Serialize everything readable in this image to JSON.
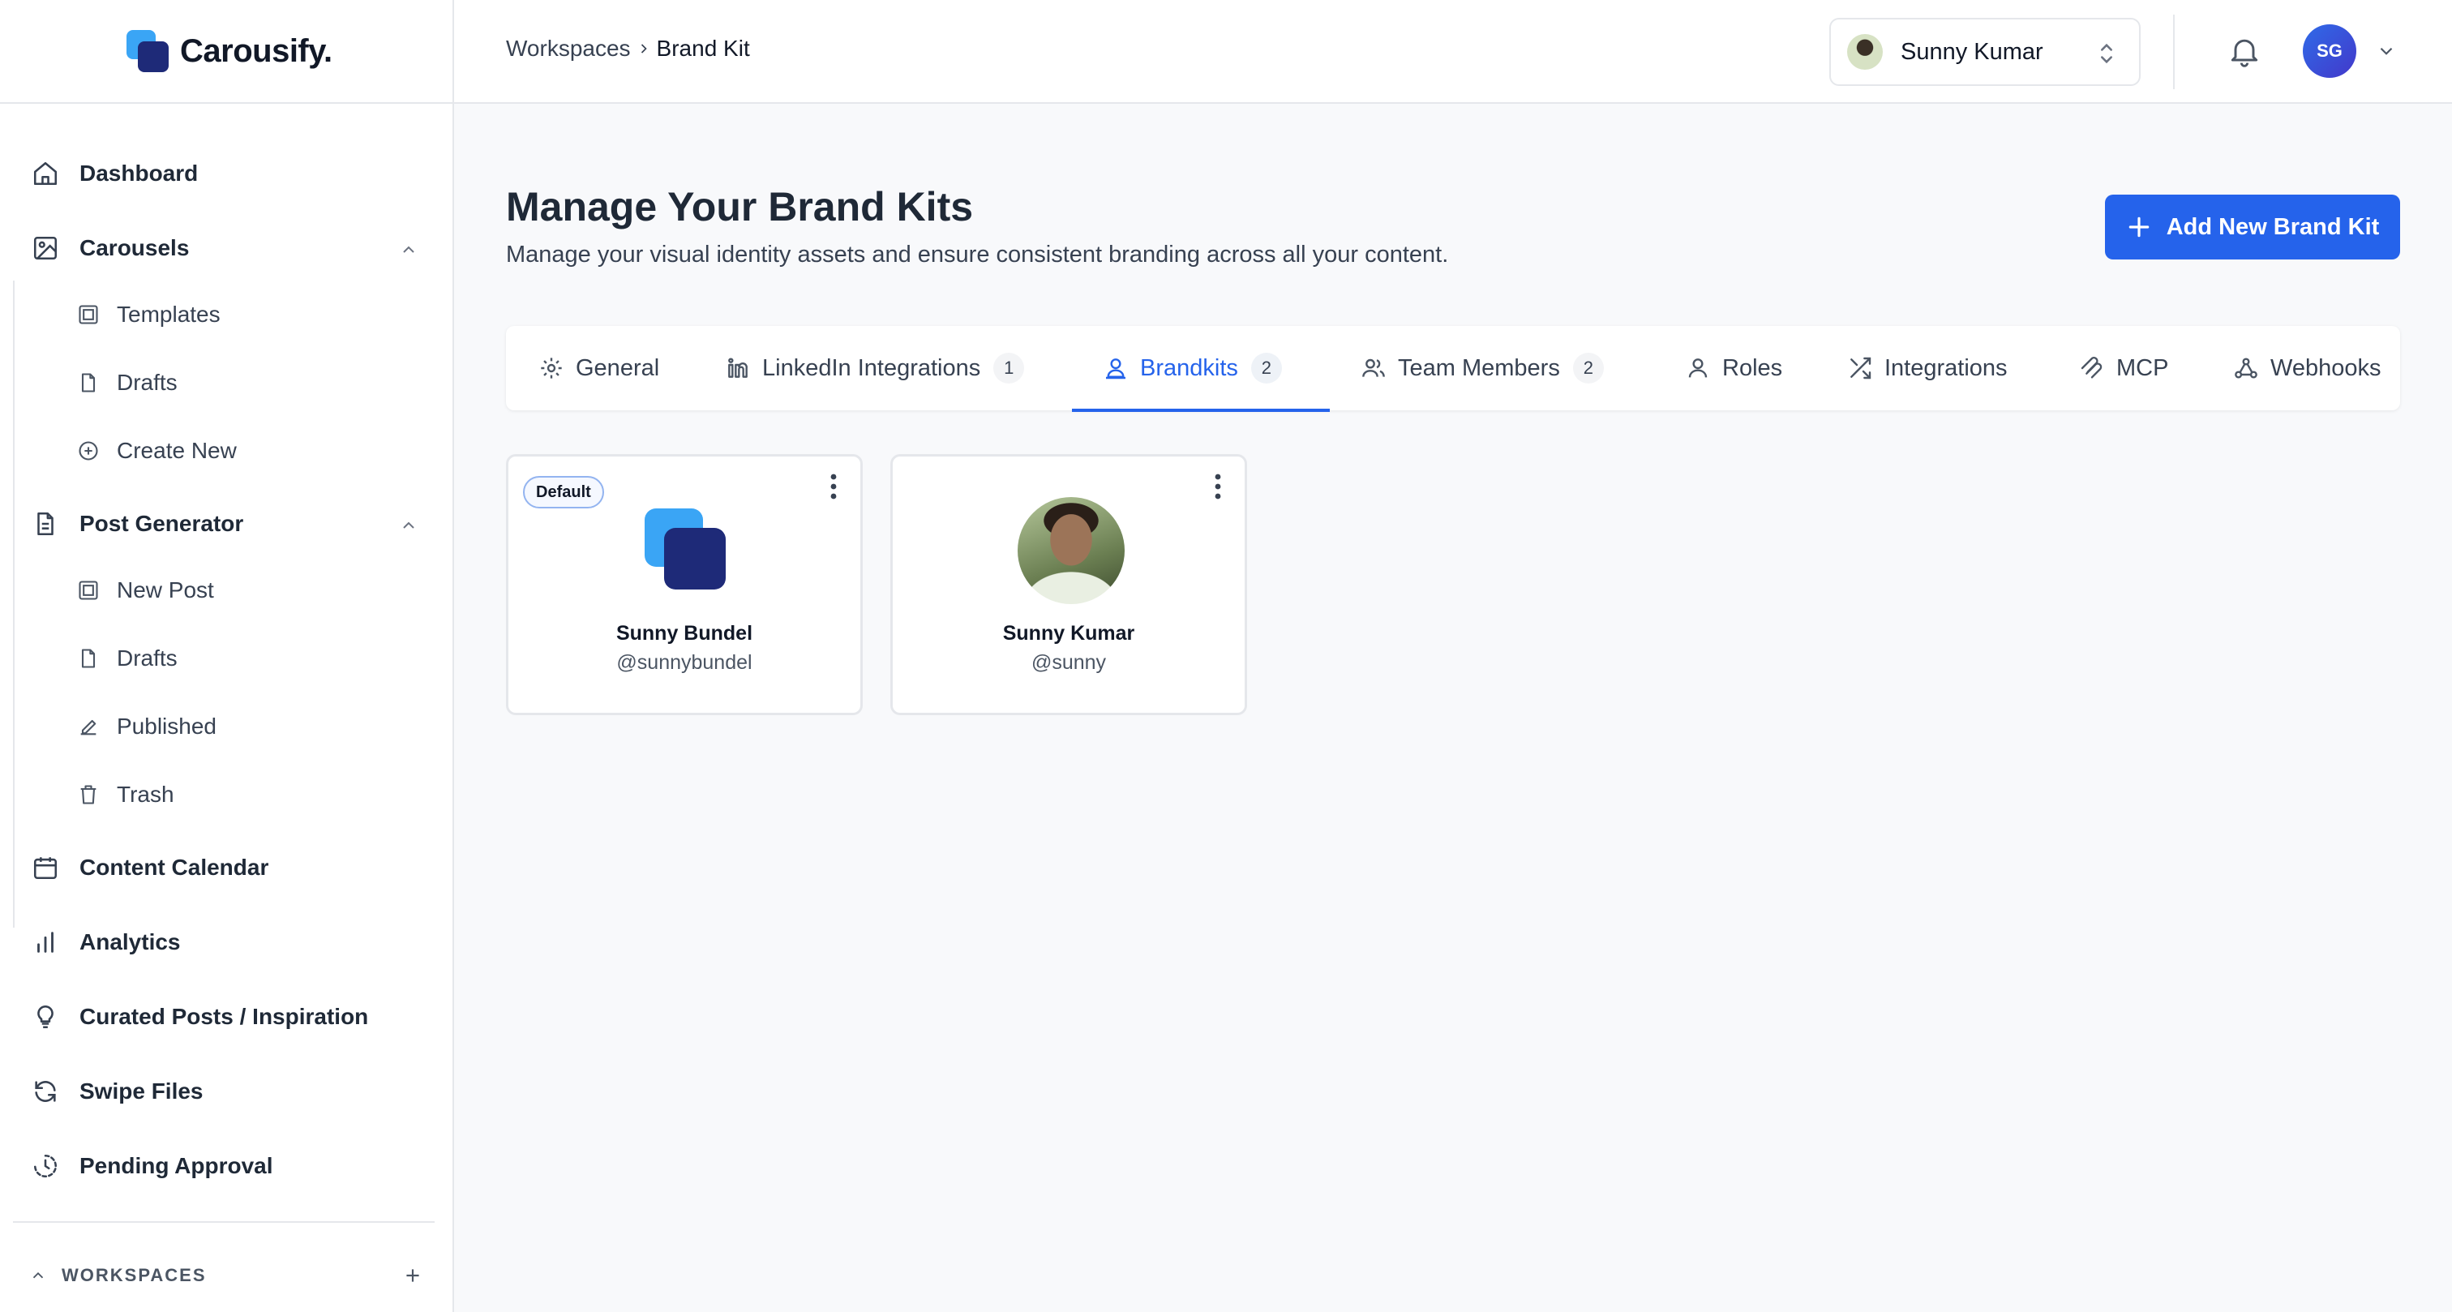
{
  "app": {
    "name": "Carousify."
  },
  "sidebar": {
    "dashboard": "Dashboard",
    "carousels": {
      "label": "Carousels",
      "items": [
        "Templates",
        "Drafts",
        "Create New"
      ]
    },
    "post_generator": {
      "label": "Post Generator",
      "items": [
        "New Post",
        "Drafts",
        "Published",
        "Trash"
      ]
    },
    "content_calendar": "Content Calendar",
    "analytics": "Analytics",
    "curated": "Curated Posts / Inspiration",
    "swipe_files": "Swipe Files",
    "pending_approval": "Pending Approval",
    "workspaces_label": "WORKSPACES"
  },
  "header": {
    "breadcrumb": [
      "Workspaces",
      "Brand Kit"
    ],
    "account_name": "Sunny Kumar",
    "user_initials": "SG"
  },
  "main": {
    "title": "Manage Your Brand Kits",
    "subtitle": "Manage your visual identity assets and ensure consistent branding across all your content.",
    "add_button": "Add New Brand Kit"
  },
  "tabs": [
    {
      "label": "General",
      "icon": "gear-icon"
    },
    {
      "label": "LinkedIn Integrations",
      "count": "1",
      "icon": "linkedin-icon"
    },
    {
      "label": "Brandkits",
      "count": "2",
      "icon": "brandkit-icon",
      "active": true
    },
    {
      "label": "Team Members",
      "count": "2",
      "icon": "users-icon"
    },
    {
      "label": "Roles",
      "icon": "user-icon"
    },
    {
      "label": "Integrations",
      "icon": "shuffle-icon"
    },
    {
      "label": "MCP",
      "icon": "mcp-icon"
    },
    {
      "label": "Webhooks",
      "icon": "webhook-icon"
    }
  ],
  "brand_kits": [
    {
      "badge": "Default",
      "name": "Sunny Bundel",
      "handle": "@sunnybundel"
    },
    {
      "name": "Sunny Kumar",
      "handle": "@sunny"
    }
  ],
  "colors": {
    "accent": "#2563eb",
    "logo_light": "#3aa5f5",
    "logo_dark": "#1e2a78"
  }
}
